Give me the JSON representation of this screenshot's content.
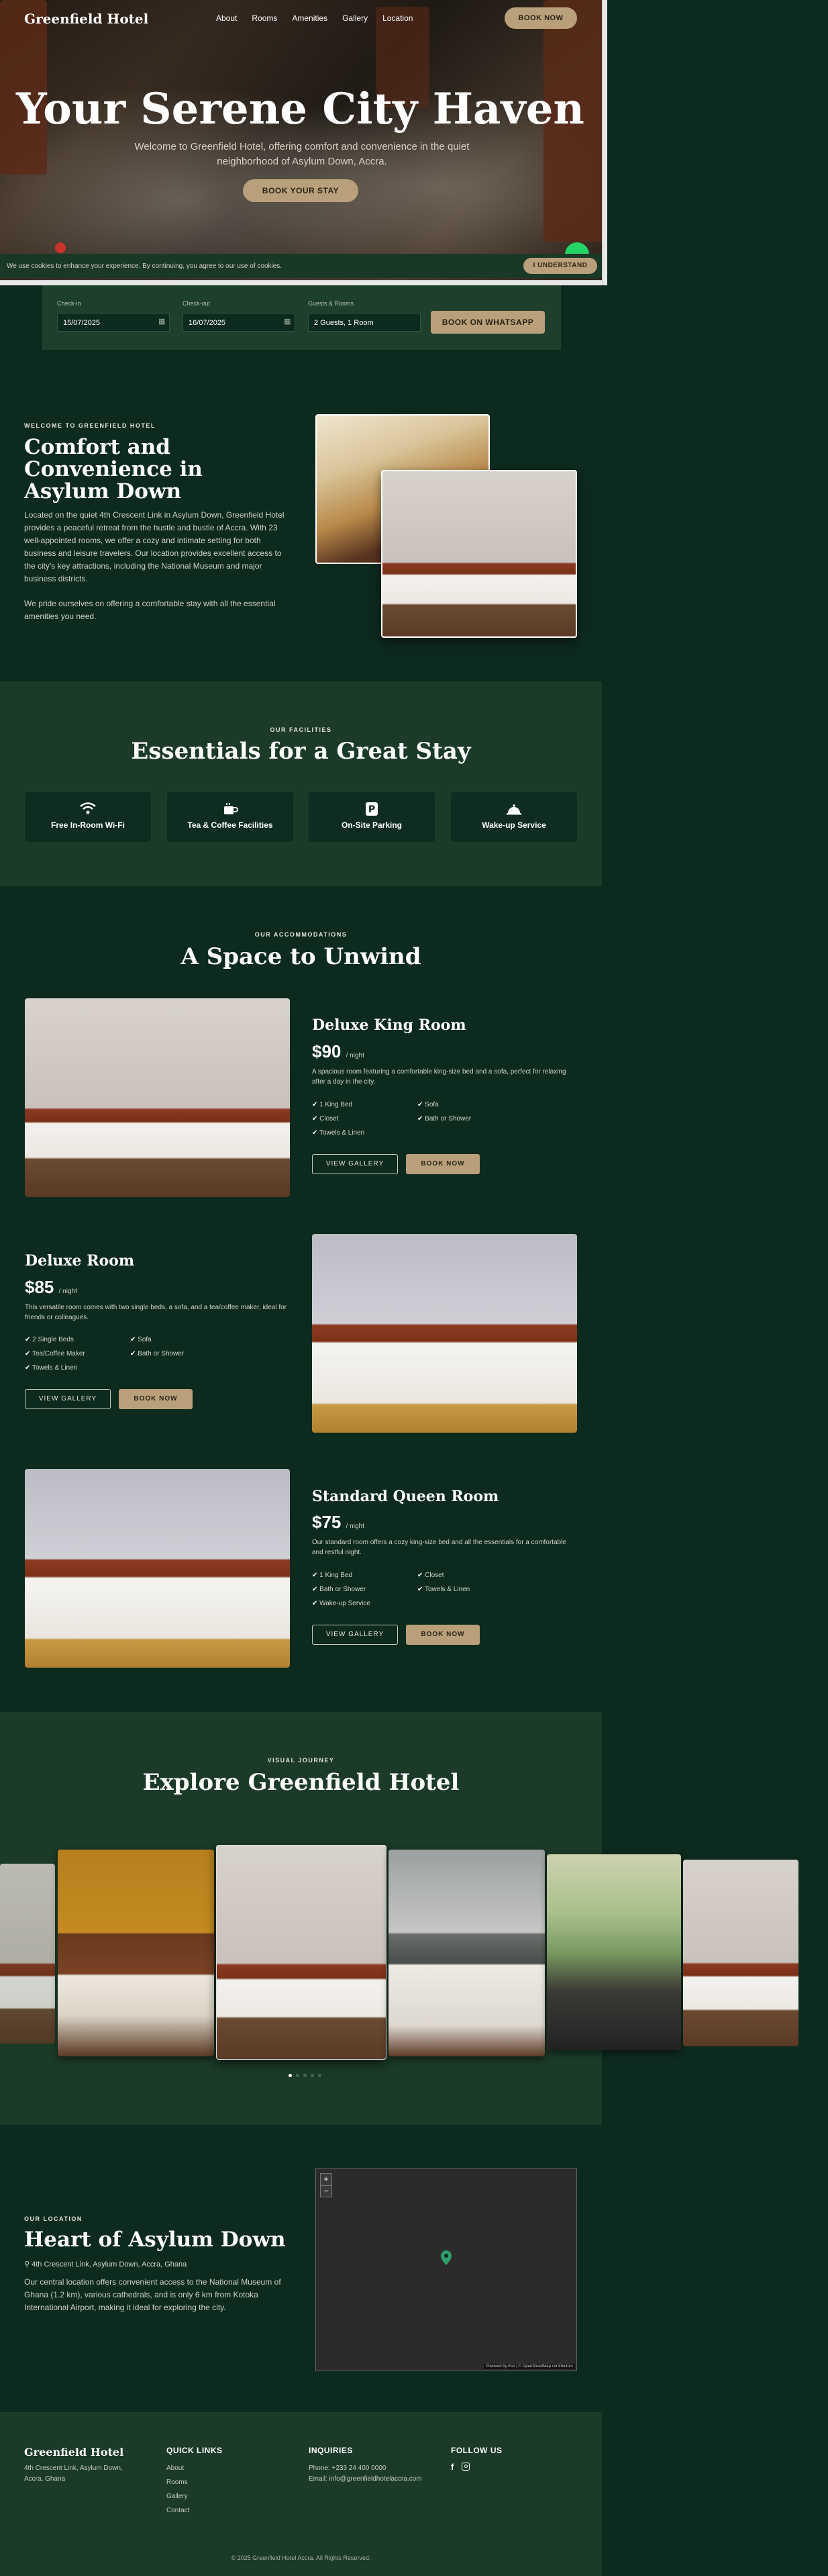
{
  "nav": {
    "logo": "Greenfield Hotel",
    "links": [
      "About",
      "Rooms",
      "Amenities",
      "Gallery",
      "Location"
    ],
    "book_now": "BOOK NOW"
  },
  "hero": {
    "title": "Your Serene City Haven",
    "subtitle": "Welcome to Greenfield Hotel, offering comfort and convenience in the quiet neighborhood of Asylum Down, Accra.",
    "cta": "BOOK YOUR STAY"
  },
  "cookie": {
    "text": "We use cookies to enhance your experience. By continuing, you agree to our use of cookies.",
    "button": "I UNDERSTAND"
  },
  "booking": {
    "checkin_label": "Check-in",
    "checkin_value": "15/07/2025",
    "checkout_label": "Check-out",
    "checkout_value": "16/07/2025",
    "guests_label": "Guests & Rooms",
    "guests_value": "2 Guests, 1 Room",
    "whatsapp": "BOOK ON WHATSAPP"
  },
  "welcome": {
    "eyebrow": "WELCOME TO GREENFIELD HOTEL",
    "title": "Comfort and Convenience in Asylum Down",
    "p1": "Located on the quiet 4th Crescent Link in Asylum Down, Greenfield Hotel provides a peaceful retreat from the hustle and bustle of Accra. With 23 well-appointed rooms, we offer a cozy and intimate setting for both business and leisure travelers. Our location provides excellent access to the city's key attractions, including the National Museum and major business districts.",
    "p2": "We pride ourselves on offering a comfortable stay with all the essential amenities you need."
  },
  "facilities": {
    "eyebrow": "OUR FACILITIES",
    "title": "Essentials for a Great Stay",
    "items": [
      {
        "label": "Free In-Room Wi-Fi",
        "icon": "wifi-icon"
      },
      {
        "label": "Tea & Coffee Facilities",
        "icon": "coffee-icon"
      },
      {
        "label": "On-Site Parking",
        "icon": "parking-icon"
      },
      {
        "label": "Wake-up Service",
        "icon": "bell-icon"
      }
    ]
  },
  "rooms": {
    "eyebrow": "OUR ACCOMMODATIONS",
    "title": "A Space to Unwind",
    "list": [
      {
        "name": "Deluxe King Room",
        "price": "$90",
        "per": "/ night",
        "desc": "A spacious room featuring a comfortable king-size bed and a sofa, perfect for relaxing after a day in the city.",
        "amenities": [
          "1 King Bed",
          "Sofa",
          "Closet",
          "Bath or Shower",
          "Towels & Linen"
        ],
        "gallery_btn": "VIEW GALLERY",
        "book_btn": "BOOK NOW"
      },
      {
        "name": "Deluxe Room",
        "price": "$85",
        "per": "/ night",
        "desc": "This versatile room comes with two single beds, a sofa, and a tea/coffee maker, ideal for friends or colleagues.",
        "amenities": [
          "2 Single Beds",
          "Sofa",
          "Tea/Coffee Maker",
          "Bath or Shower",
          "Towels & Linen"
        ],
        "gallery_btn": "VIEW GALLERY",
        "book_btn": "BOOK NOW"
      },
      {
        "name": "Standard Queen Room",
        "price": "$75",
        "per": "/ night",
        "desc": "Our standard room offers a cozy king-size bed and all the essentials for a comfortable and restful night.",
        "amenities": [
          "1 King Bed",
          "Closet",
          "Bath or Shower",
          "Towels & Linen",
          "Wake-up Service"
        ],
        "gallery_btn": "VIEW GALLERY",
        "book_btn": "BOOK NOW"
      }
    ]
  },
  "gallery": {
    "eyebrow": "VISUAL JOURNEY",
    "title": "Explore Greenfield Hotel"
  },
  "location": {
    "eyebrow": "OUR LOCATION",
    "title": "Heart of Asylum Down",
    "address": "4th Crescent Link, Asylum Down, Accra, Ghana",
    "text": "Our central location offers convenient access to the National Museum of Ghana (1.2 km), various cathedrals, and is only 6 km from Kotoka International Airport, making it ideal for exploring the city.",
    "map_attribution": "Powered by Esri | © OpenStreetMap contributors"
  },
  "footer": {
    "brand": "Greenfield Hotel",
    "address": "4th Crescent Link, Asylum Down, Accra, Ghana",
    "quick_links_title": "QUICK LINKS",
    "quick_links": [
      "About",
      "Rooms",
      "Gallery",
      "Contact"
    ],
    "inquiries_title": "INQUIRIES",
    "phone": "Phone: +233 24 400 0000",
    "email": "Email: info@greenfieldhotelaccra.com",
    "follow_title": "FOLLOW US",
    "copyright": "© 2025 Greenfield Hotel Accra. All Rights Reserved."
  },
  "colors": {
    "background": "#0d2a1e",
    "section_alt": "#1b3a28",
    "accent": "#b9a07a",
    "text": "#e8e4dc"
  }
}
